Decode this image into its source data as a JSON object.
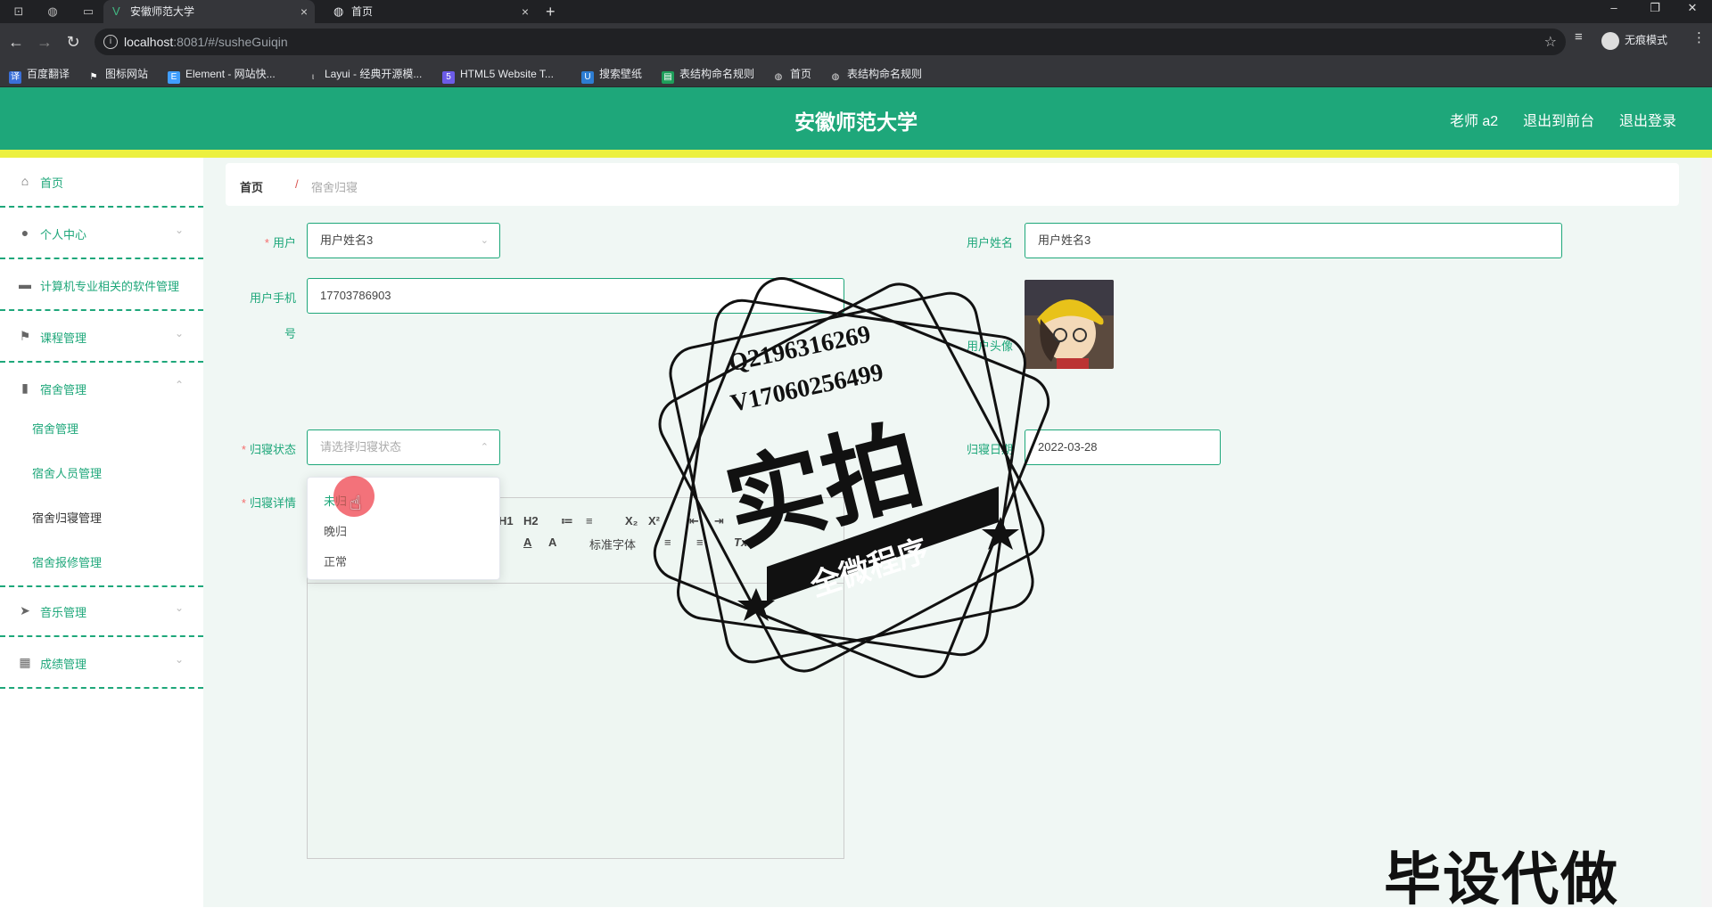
{
  "browser": {
    "tabs": [
      {
        "title": "安徽师范大学",
        "active": true
      },
      {
        "title": "首页",
        "active": false
      }
    ],
    "url_host": "localhost",
    "url_rest": ":8081/#/susheGuiqin",
    "profile_label": "无痕模式",
    "bookmarks": [
      {
        "label": "百度翻译",
        "icon": "translate-icon",
        "color": "#3a6fd8"
      },
      {
        "label": "图标网站",
        "icon": "flag-icon",
        "color": "#444"
      },
      {
        "label": "Element - 网站快...",
        "icon": "element-icon",
        "color": "#409eff"
      },
      {
        "label": "Layui - 经典开源模...",
        "icon": "layui-icon",
        "color": "#555"
      },
      {
        "label": "HTML5 Website T...",
        "icon": "html5-icon",
        "color": "#6c5ce7"
      },
      {
        "label": "搜索壁纸",
        "icon": "wallpaper-icon",
        "color": "#2d7dd2"
      },
      {
        "label": "表结构命名规则",
        "icon": "sheet-icon",
        "color": "#1e9e5a"
      },
      {
        "label": "首页",
        "icon": "globe-icon",
        "color": "#666"
      },
      {
        "label": "表结构命名规则",
        "icon": "globe-icon",
        "color": "#666"
      }
    ]
  },
  "header": {
    "title": "安徽师范大学",
    "links": [
      "老师 a2",
      "退出到前台",
      "退出登录"
    ]
  },
  "sidebar": {
    "items": [
      {
        "label": "首页",
        "icon": "home-icon",
        "arrow": ""
      },
      {
        "label": "个人中心",
        "icon": "user-icon",
        "arrow": "⌄"
      },
      {
        "label": "计算机专业相关的软件管理",
        "icon": "briefcase-icon",
        "arrow": ""
      },
      {
        "label": "课程管理",
        "icon": "flag-icon",
        "arrow": "⌄"
      },
      {
        "label": "宿舍管理",
        "icon": "bar-chart-icon",
        "arrow": "⌃"
      },
      {
        "label": "音乐管理",
        "icon": "send-icon",
        "arrow": "⌄"
      },
      {
        "label": "成绩管理",
        "icon": "grid-icon",
        "arrow": "⌄"
      }
    ],
    "submenu": [
      "宿舍管理",
      "宿舍人员管理",
      "宿舍归寝管理",
      "宿舍报修管理"
    ]
  },
  "breadcrumb": {
    "home": "首页",
    "separator": "/",
    "current": "宿舍归寝"
  },
  "form": {
    "user_label": "用户",
    "user_value": "用户姓名3",
    "username_label": "用户姓名",
    "username_value": "用户姓名3",
    "phone_label_line1": "用户手机",
    "phone_label_line2": "号",
    "phone_value": "17703786903",
    "avatar_label": "用户头像",
    "status_label": "归寝状态",
    "status_placeholder": "请选择归寝状态",
    "date_label": "归寝日期",
    "date_value": "2022-03-28",
    "detail_label": "归寝详情",
    "status_options": [
      "未归",
      "晚归",
      "正常"
    ]
  },
  "editor": {
    "toolbar": [
      "H1",
      "H2",
      "≔",
      "≡",
      "X₂",
      "X²",
      "⇤",
      "⇥",
      "A",
      "A",
      "标准字体",
      "≡",
      "≡",
      "Tx"
    ]
  },
  "watermark": {
    "contact_q": "Q2196316269",
    "contact_v": "V17060256499",
    "big_text": "实拍",
    "banner_text": "全微程序",
    "bottom_text": "毕设代做"
  },
  "colors": {
    "primary": "#1ea77a",
    "accent_strip": "#ecf03f",
    "required": "#f56c6c"
  }
}
